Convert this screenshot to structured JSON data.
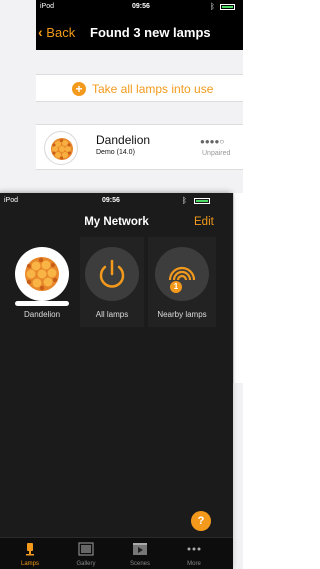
{
  "colors": {
    "accent": "#f39a1c",
    "dark_bg": "#1b1b1b",
    "tile_bg": "#222222",
    "circle_bg": "#3d3d3d",
    "battery": "#4cd964"
  },
  "back_screen": {
    "status": {
      "carrier": "iPod",
      "time": "09:56"
    },
    "nav": {
      "back_label": "Back",
      "title": "Found 3 new lamps"
    },
    "take_all_label": "Take all lamps into use",
    "lamp": {
      "name": "Dandelion",
      "subtitle": "Demo (14.0)",
      "signal": "●●●●○",
      "state": "Unpaired"
    }
  },
  "front_screen": {
    "status": {
      "carrier": "iPod",
      "time": "09:56"
    },
    "nav": {
      "title": "My Network",
      "edit_label": "Edit"
    },
    "tiles": [
      {
        "label": "Dandelion",
        "icon": "dandelion-lamp-icon"
      },
      {
        "label": "All lamps",
        "icon": "power-icon"
      },
      {
        "label": "Nearby lamps",
        "icon": "signal-arcs-icon",
        "badge": "1"
      }
    ],
    "help_label": "?",
    "tabs": [
      {
        "label": "Lamps",
        "icon": "lamp-icon",
        "active": true
      },
      {
        "label": "Gallery",
        "icon": "gallery-icon",
        "active": false
      },
      {
        "label": "Scenes",
        "icon": "scenes-icon",
        "active": false
      },
      {
        "label": "More",
        "icon": "more-icon",
        "active": false
      }
    ]
  }
}
